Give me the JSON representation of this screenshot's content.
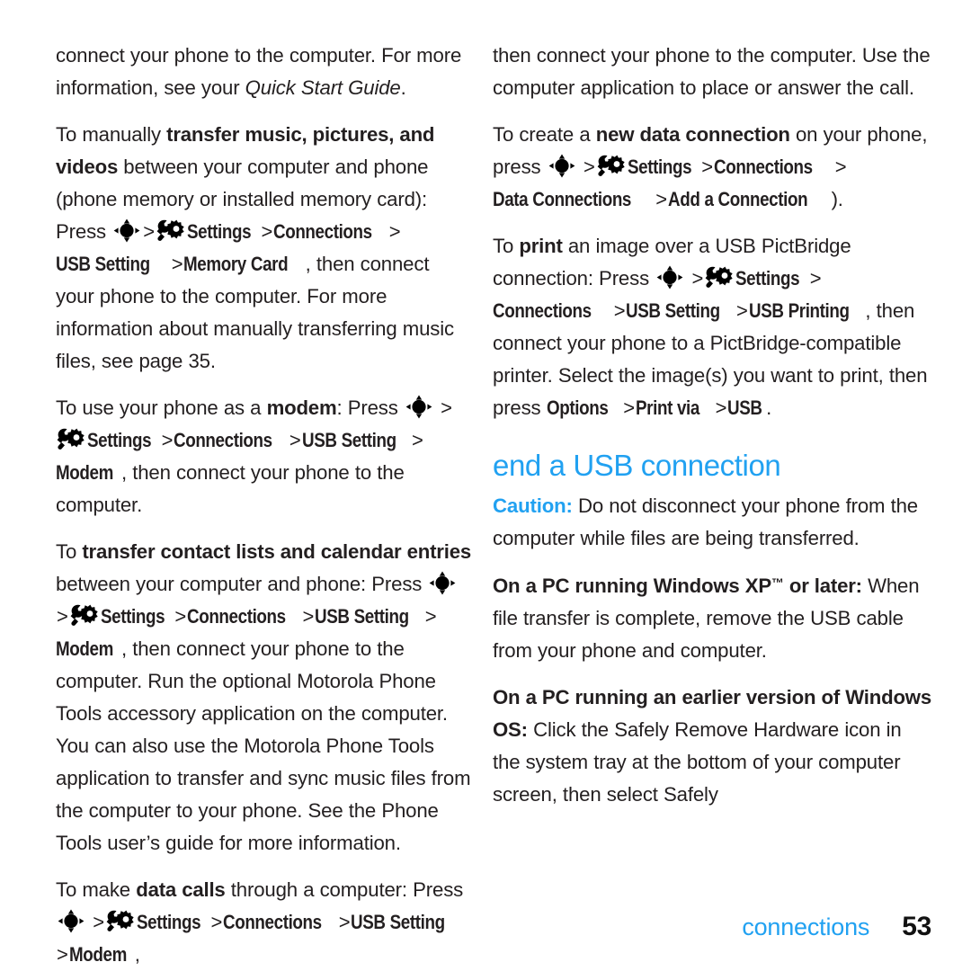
{
  "document": {
    "type": "printed-manual-page",
    "page_number": "53",
    "chapter_label": "connections",
    "accent_color": "#21a1f1",
    "text_color": "#231f20"
  },
  "icons": {
    "nav_key": "navigation-key-icon",
    "settings": "settings-wrench-gear-icon"
  },
  "left_column": {
    "p1": {
      "t1": "connect your phone to the computer. For more information, see your ",
      "italic1": "Quick Start Guide",
      "t2": "."
    },
    "p2": {
      "t1": "To manually ",
      "b1": "transfer music, pictures, and videos",
      "t2": " between your computer and phone (phone memory or installed memory card): Press ",
      "sep": ">",
      "m1": "Settings",
      "m2": "Connections",
      "m3": "USB Setting",
      "m4": "Memory Card",
      "t3": ", then connect your phone to the computer. For more information about manually transferring music files, see page 35."
    },
    "p3": {
      "t1": "To use your phone as a ",
      "b1": "modem",
      "t2": ": Press ",
      "sep": ">",
      "m1": "Settings",
      "m2": "Connections",
      "m3": "USB Setting",
      "m4": "Modem",
      "t3": ", then connect your phone to the computer."
    },
    "p4": {
      "t1": "To ",
      "b1": "transfer contact lists and calendar entries",
      "t2": " between your computer and phone: Press ",
      "sep": ">",
      "m1": "Settings",
      "m2": "Connections",
      "m3": "USB Setting",
      "m4": "Modem",
      "t3": ", then connect your phone to the computer. Run the optional Motorola Phone Tools accessory application on the computer. You can also use the Motorola Phone Tools application to transfer and sync music files from the computer to your phone. See the Phone Tools user’s guide for more information."
    },
    "p5": {
      "t1": "To make ",
      "b1": "data calls",
      "t2": " through a computer: Press ",
      "sep": ">",
      "m1": "Settings",
      "m2": "Connections",
      "m3": "USB Setting",
      "m4": "Modem",
      "t3": ","
    }
  },
  "right_column": {
    "p1": {
      "t1": "then connect your phone to the computer. Use the computer application to place or answer the call."
    },
    "p2": {
      "t1": "To create a ",
      "b1": "new data connection",
      "t2": " on your phone, press ",
      "sep": ">",
      "m1": "Settings",
      "m2": "Connections",
      "m3": "Data Connections",
      "m4": "Add a Connection",
      "t3": ")."
    },
    "p3": {
      "t1": "To ",
      "b1": "print",
      "t2": " an image over a USB PictBridge connection: Press ",
      "sep": ">",
      "m1": "Settings",
      "m2": "Connections",
      "m3": "USB Setting",
      "m4": "USB Printing",
      "t3": ", then connect your phone to a PictBridge-compatible printer. Select the image(s) you want to print, then press ",
      "m5": "Options",
      "m6": "Print via",
      "m7": "USB",
      "t4": "."
    },
    "heading": "end a USB connection",
    "p4": {
      "label": "Caution:",
      "t1": " Do not disconnect your phone from the computer while files are being transferred."
    },
    "p5": {
      "b1": "On a PC running Windows XP",
      "tm": "™",
      "b2": " or later:",
      "t1": " When file transfer is complete, remove the USB cable from your phone and computer."
    },
    "p6": {
      "b1": "On a PC running an earlier version of Windows OS:",
      "t1": " Click the Safely Remove Hardware icon in the system tray at the bottom of your computer screen, then select Safely"
    }
  }
}
